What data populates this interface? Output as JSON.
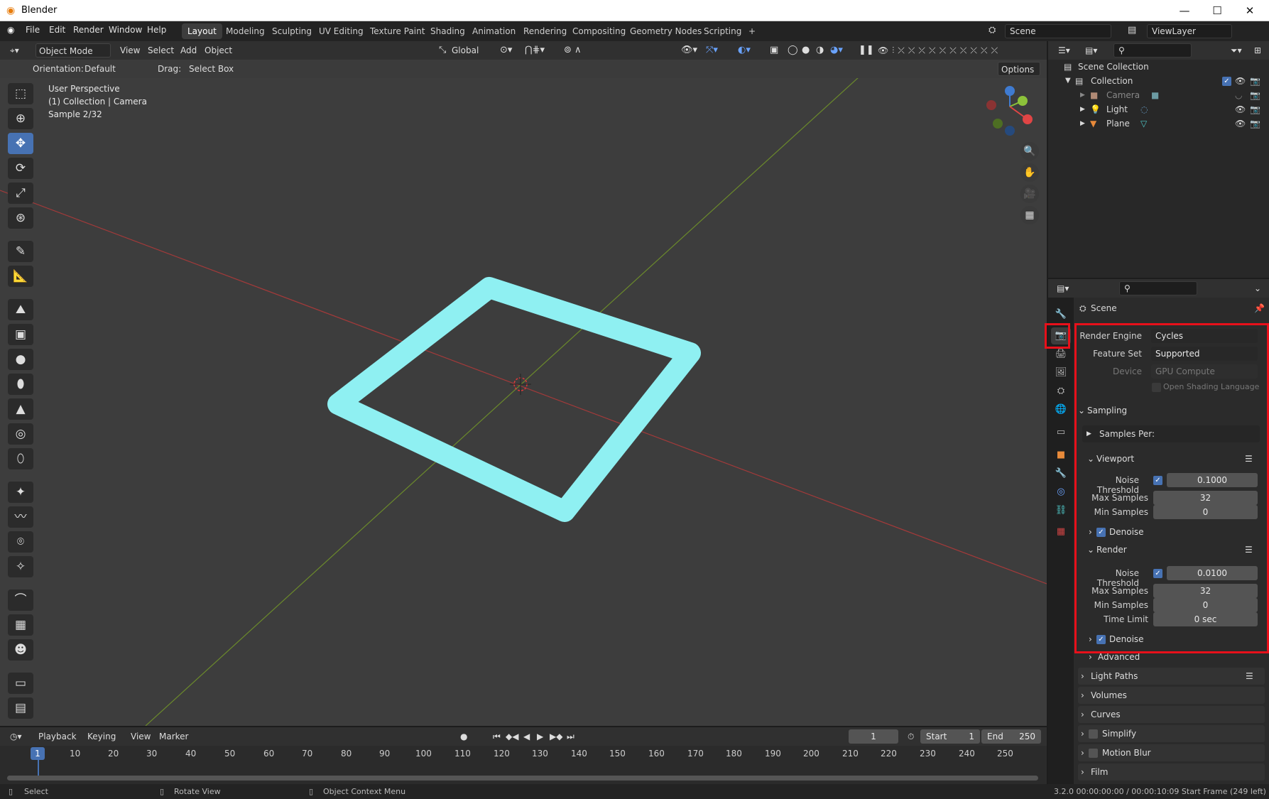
{
  "window": {
    "title": "Blender",
    "minimize": "—",
    "maximize": "☐",
    "close": "✕"
  },
  "menu": {
    "items": [
      "File",
      "Edit",
      "Render",
      "Window",
      "Help"
    ]
  },
  "workspaces": [
    "Layout",
    "Modeling",
    "Sculpting",
    "UV Editing",
    "Texture Paint",
    "Shading",
    "Animation",
    "Rendering",
    "Compositing",
    "Geometry Nodes",
    "Scripting",
    "+"
  ],
  "active_workspace": "Layout",
  "scene_field": "Scene",
  "viewlayer_field": "ViewLayer",
  "viewport_header": {
    "mode": "Object Mode",
    "menus": [
      "View",
      "Select",
      "Add",
      "Object"
    ],
    "transform_orientation": "Global"
  },
  "tool_header": {
    "orientation_label": "Orientation:",
    "orientation_value": "Default",
    "drag_label": "Drag:",
    "drag_value": "Select Box",
    "options": "Options"
  },
  "viewport_info": {
    "line1": "User Perspective",
    "line2": "(1) Collection | Camera",
    "line3": "Sample 2/32"
  },
  "outliner": {
    "root": "Scene Collection",
    "collection": "Collection",
    "objects": [
      "Camera",
      "Light",
      "Plane"
    ]
  },
  "properties": {
    "context": "Scene",
    "render_engine_label": "Render Engine",
    "render_engine": "Cycles",
    "feature_set_label": "Feature Set",
    "feature_set": "Supported",
    "device_label": "Device",
    "device": "GPU Compute",
    "osl_label": "Open Shading Language",
    "sampling": "Sampling",
    "samples_per": "Samples Per:",
    "viewport": {
      "title": "Viewport",
      "noise_threshold_label": "Noise Threshold",
      "noise_threshold": "0.1000",
      "max_samples_label": "Max Samples",
      "max_samples": "32",
      "min_samples_label": "Min Samples",
      "min_samples": "0",
      "denoise": "Denoise"
    },
    "render": {
      "title": "Render",
      "noise_threshold_label": "Noise Threshold",
      "noise_threshold": "0.0100",
      "max_samples_label": "Max Samples",
      "max_samples": "32",
      "min_samples_label": "Min Samples",
      "min_samples": "0",
      "time_limit_label": "Time Limit",
      "time_limit": "0 sec",
      "denoise": "Denoise"
    },
    "advanced": "Advanced",
    "panels": [
      "Light Paths",
      "Volumes",
      "Curves",
      "Simplify",
      "Motion Blur",
      "Film"
    ]
  },
  "timeline": {
    "menus": [
      "Playback",
      "Keying",
      "View",
      "Marker"
    ],
    "current_frame": "1",
    "start_label": "Start",
    "start": "1",
    "end_label": "End",
    "end": "250",
    "ticks": [
      "1",
      "10",
      "20",
      "30",
      "40",
      "50",
      "60",
      "70",
      "80",
      "90",
      "100",
      "110",
      "120",
      "130",
      "140",
      "150",
      "160",
      "170",
      "180",
      "190",
      "200",
      "210",
      "220",
      "230",
      "240",
      "250"
    ]
  },
  "statusbar": {
    "select": "Select",
    "rotate": "Rotate View",
    "context_menu": "Object Context Menu",
    "info": "3.2.0  00:00:00:00 / 00:00:10:09  Start Frame (249 left)"
  },
  "colors": {
    "accent": "#4772b3",
    "highlight": "#e8101a",
    "plane": "#7fe8ec"
  }
}
